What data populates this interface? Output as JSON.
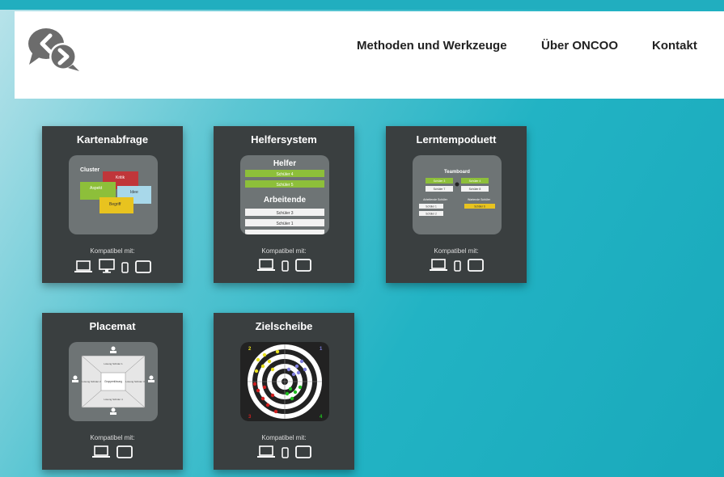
{
  "nav": {
    "items": [
      "Methoden und Werkzeuge",
      "Über ONCOO",
      "Kontakt"
    ]
  },
  "colors": {
    "card_bg": "#3a3f40",
    "accent_teal": "#21aebf"
  },
  "cards": [
    {
      "title": "Kartenabfrage",
      "compat_label": "Kompatibel mit:",
      "devices": [
        "laptop-icon",
        "desktop-icon",
        "phone-icon",
        "tablet-icon"
      ],
      "thumb": {
        "cluster": "Cluster",
        "kritik": "Kritik",
        "aspekt": "Aspekt",
        "idee": "Idee",
        "begriff": "Begriff"
      }
    },
    {
      "title": "Helfersystem",
      "compat_label": "Kompatibel mit:",
      "devices": [
        "laptop-icon",
        "phone-icon",
        "tablet-icon"
      ],
      "thumb": {
        "helfer": "Helfer",
        "helfer_rows": [
          "Schüler 4",
          "Schüler 5"
        ],
        "arbeitende": "Arbeitende",
        "arbeitende_rows": [
          "Schüler 3",
          "Schüler 1"
        ]
      }
    },
    {
      "title": "Lerntempoduett",
      "compat_label": "Kompatibel mit:",
      "devices": [
        "laptop-icon",
        "phone-icon",
        "tablet-icon"
      ],
      "thumb": {
        "teamboard": "Teamboard",
        "pairs": [
          [
            "Schüler 3",
            "Schüler 4"
          ],
          [
            "Schüler 7",
            "Schüler 8"
          ]
        ],
        "arbeitende": "Arbeitende Schüler",
        "wartende": "Wartende Schüler",
        "arbeitende_rows": [
          "Schüler 1",
          "Schüler 2"
        ],
        "wartende_rows": [
          "Schüler 6"
        ]
      }
    },
    {
      "title": "Placemat",
      "compat_label": "Kompatibel mit:",
      "devices": [
        "laptop-icon",
        "tablet-icon"
      ],
      "thumb": {
        "center": "Gruppenlösung",
        "top": "Lösung Schüler 1",
        "left": "Lösung Schüler 2",
        "right": "Lösung Schüler 3",
        "bottom": "Lösung Schüler 4"
      }
    },
    {
      "title": "Zielscheibe",
      "compat_label": "Kompatibel mit:",
      "devices": [
        "laptop-icon",
        "phone-icon",
        "tablet-icon"
      ],
      "thumb": {
        "q1": "1",
        "q2": "2",
        "q3": "3",
        "q4": "4"
      }
    }
  ]
}
